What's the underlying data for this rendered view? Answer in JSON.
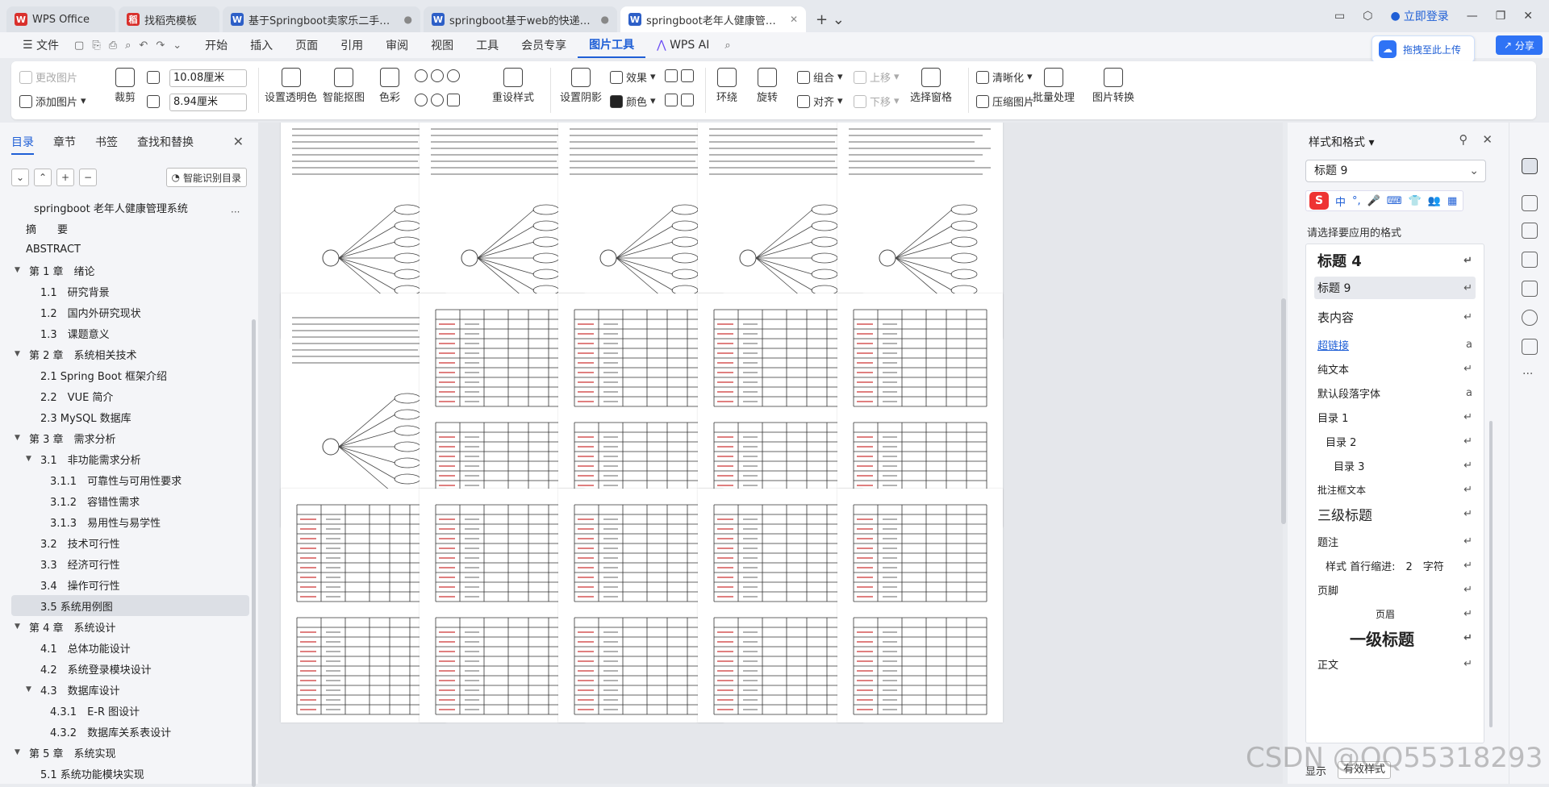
{
  "tabs": [
    {
      "label": "WPS Office",
      "icon": "W",
      "color": "#d9302c",
      "active": false
    },
    {
      "label": "找稻壳模板",
      "icon": "稻",
      "color": "#d9302c",
      "active": false
    },
    {
      "label": "基于Springboot卖家乐二手电子",
      "icon": "W",
      "color": "#2d5fc7",
      "active": false
    },
    {
      "label": "springboot基于web的快递物流信息",
      "icon": "W",
      "color": "#2d5fc7",
      "active": false
    },
    {
      "label": "springboot老年人健康管理系",
      "icon": "W",
      "color": "#2d5fc7",
      "active": true
    }
  ],
  "window": {
    "login": "立即登录",
    "upload": "拖拽至此上传",
    "share": "分享"
  },
  "menu": {
    "file": "文件",
    "items": [
      "开始",
      "插入",
      "页面",
      "引用",
      "审阅",
      "视图",
      "工具",
      "会员专享",
      "图片工具"
    ],
    "active": "图片工具",
    "ai": "WPS AI"
  },
  "ribbon": {
    "change_pic": "更改图片",
    "add_pic": "添加图片",
    "crop": "裁剪",
    "width": "10.08厘米",
    "height": "8.94厘米",
    "set_transparent": "设置透明色",
    "smart_cutout": "智能抠图",
    "color": "色彩",
    "recolor": "重设样式",
    "set_shadow": "设置阴影",
    "effect": "效果",
    "fill_color": "颜色",
    "wrap": "环绕",
    "rotate": "旋转",
    "group": "组合",
    "align": "对齐",
    "bring_forward": "上移",
    "send_backward": "下移",
    "selection_pane": "选择窗格",
    "sharpen": "清晰化",
    "compress": "压缩图片",
    "batch": "批量处理",
    "convert": "图片转换"
  },
  "left": {
    "tabs": [
      "目录",
      "章节",
      "书签",
      "查找和替换"
    ],
    "active_tab": "目录",
    "smart_toc": "智能识别目录",
    "toc": [
      {
        "label": "springboot 老年人健康管理系统",
        "level": 0,
        "arrow": ""
      },
      {
        "label": "摘　　要",
        "level": 0,
        "arrow": ""
      },
      {
        "label": "ABSTRACT",
        "level": 0,
        "arrow": ""
      },
      {
        "label": "第 1 章　绪论",
        "level": 1,
        "arrow": "▼"
      },
      {
        "label": "1.1　研究背景",
        "level": 2,
        "arrow": ""
      },
      {
        "label": "1.2　国内外研究现状",
        "level": 2,
        "arrow": ""
      },
      {
        "label": "1.3　课题意义",
        "level": 2,
        "arrow": ""
      },
      {
        "label": "第 2 章　系统相关技术",
        "level": 1,
        "arrow": "▼"
      },
      {
        "label": "2.1 Spring Boot 框架介绍",
        "level": 2,
        "arrow": ""
      },
      {
        "label": "2.2　VUE 简介",
        "level": 2,
        "arrow": ""
      },
      {
        "label": "2.3 MySQL 数据库",
        "level": 2,
        "arrow": ""
      },
      {
        "label": "第 3 章　需求分析",
        "level": 1,
        "arrow": "▼"
      },
      {
        "label": "3.1　非功能需求分析",
        "level": 2,
        "arrow": "▼"
      },
      {
        "label": "3.1.1　可靠性与可用性要求",
        "level": 3,
        "arrow": ""
      },
      {
        "label": "3.1.2　容错性需求",
        "level": 3,
        "arrow": ""
      },
      {
        "label": "3.1.3　易用性与易学性",
        "level": 3,
        "arrow": ""
      },
      {
        "label": "3.2　技术可行性",
        "level": 2,
        "arrow": ""
      },
      {
        "label": "3.3　经济可行性",
        "level": 2,
        "arrow": ""
      },
      {
        "label": "3.4　操作可行性",
        "level": 2,
        "arrow": ""
      },
      {
        "label": "3.5 系统用例图",
        "level": 2,
        "arrow": "",
        "selected": true
      },
      {
        "label": "第 4 章　系统设计",
        "level": 1,
        "arrow": "▼"
      },
      {
        "label": "4.1　总体功能设计",
        "level": 2,
        "arrow": ""
      },
      {
        "label": "4.2　系统登录模块设计",
        "level": 2,
        "arrow": ""
      },
      {
        "label": "4.3　数据库设计",
        "level": 2,
        "arrow": "▼"
      },
      {
        "label": "4.3.1　E-R 图设计",
        "level": 3,
        "arrow": ""
      },
      {
        "label": "4.3.2　数据库关系表设计",
        "level": 3,
        "arrow": ""
      },
      {
        "label": "第 5 章　系统实现",
        "level": 1,
        "arrow": "▼"
      },
      {
        "label": "5.1 系统功能模块实现",
        "level": 2,
        "arrow": ""
      }
    ]
  },
  "right": {
    "title": "样式和格式",
    "current": "标题 9",
    "prompt": "请选择要应用的格式",
    "ime": [
      "中",
      "°,",
      "🎤",
      "⌨",
      "👕",
      "👥",
      "▦"
    ],
    "styles": [
      {
        "label": "标题 4",
        "size": 18,
        "bold": true,
        "indent": 0,
        "ret": "↵"
      },
      {
        "label": "标题 9",
        "size": 14,
        "bold": false,
        "indent": 0,
        "ret": "↵",
        "selected": true
      },
      {
        "label": "表内容",
        "size": 15,
        "bold": false,
        "indent": 0,
        "ret": "↵"
      },
      {
        "label": "超链接",
        "size": 13,
        "bold": false,
        "indent": 0,
        "ret": "a",
        "link": true
      },
      {
        "label": "纯文本",
        "size": 13,
        "bold": false,
        "indent": 0,
        "ret": "↵"
      },
      {
        "label": "默认段落字体",
        "size": 13,
        "bold": false,
        "indent": 0,
        "ret": "a"
      },
      {
        "label": "目录 1",
        "size": 13,
        "bold": false,
        "indent": 0,
        "ret": "↵"
      },
      {
        "label": "目录 2",
        "size": 13,
        "bold": false,
        "indent": 10,
        "ret": "↵"
      },
      {
        "label": "目录 3",
        "size": 13,
        "bold": false,
        "indent": 20,
        "ret": "↵"
      },
      {
        "label": "批注框文本",
        "size": 12,
        "bold": false,
        "indent": 0,
        "ret": "↵"
      },
      {
        "label": "三级标题",
        "size": 17,
        "bold": false,
        "indent": 0,
        "ret": "↵"
      },
      {
        "label": "题注",
        "size": 13,
        "bold": false,
        "indent": 0,
        "ret": "↵"
      },
      {
        "label": "样式  首行缩进:　2　字符",
        "size": 13,
        "bold": false,
        "indent": 10,
        "ret": "↵"
      },
      {
        "label": "页脚",
        "size": 13,
        "bold": false,
        "indent": 0,
        "ret": "↵"
      },
      {
        "label": "页眉",
        "size": 12,
        "bold": false,
        "indent": 72,
        "ret": "↵"
      },
      {
        "label": "一级标题",
        "size": 20,
        "bold": true,
        "indent": 40,
        "ret": "↵"
      },
      {
        "label": "正文",
        "size": 13,
        "bold": false,
        "indent": 0,
        "ret": "↵"
      }
    ],
    "bottom_show": "显示",
    "bottom_valid": "有效样式"
  },
  "watermark": "CSDN @QQ55318293"
}
